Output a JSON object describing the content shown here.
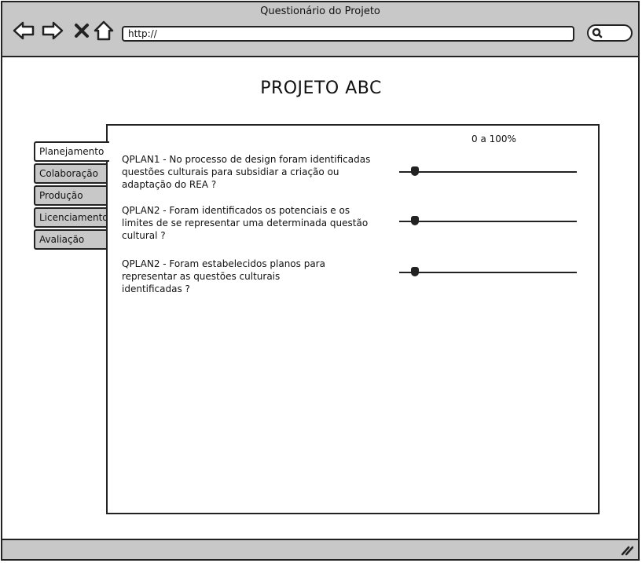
{
  "browser": {
    "title": "Questionário do Projeto",
    "url": "http://",
    "icons": [
      "back-arrow-icon",
      "forward-arrow-icon",
      "close-icon",
      "home-icon",
      "search-icon",
      "resize-grip-icon"
    ]
  },
  "page": {
    "heading": "PROJETO ABC",
    "scale_label": "0 a 100%"
  },
  "tabs": [
    {
      "label": "Planejamento",
      "active": true
    },
    {
      "label": "Colaboração",
      "active": false
    },
    {
      "label": "Produção",
      "active": false
    },
    {
      "label": "Licenciamento",
      "active": false
    },
    {
      "label": "Avaliação",
      "active": false
    }
  ],
  "questions": [
    {
      "text": "QPLAN1 - No processo de design foram identificadas\nquestões culturais para subsidiar a criação ou\nadaptação do REA ?",
      "value_percent": 7
    },
    {
      "text": "QPLAN2 - Foram identificados os potenciais e os\nlimites de se representar uma determinada questão\ncultural ?",
      "value_percent": 7
    },
    {
      "text": "QPLAN2 - Foram estabelecidos planos para\nrepresentar as questões culturais\nidentificadas ?",
      "value_percent": 7
    }
  ],
  "colors": {
    "chrome": "#c8c8c8",
    "stroke": "#222222",
    "background": "#ffffff"
  }
}
